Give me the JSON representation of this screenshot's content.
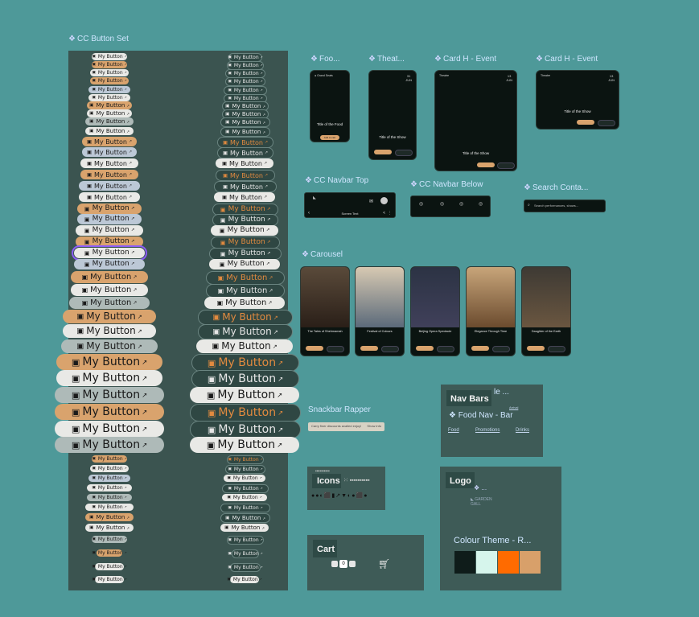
{
  "frames": {
    "button_set": "CC Button Set",
    "food": "Foo...",
    "theatre": "Theat...",
    "card_h_event_1": "Card H - Event",
    "card_h_event_2": "Card H - Event",
    "navbar_top": "CC Navbar Top",
    "navbar_below": "CC Navbar Below",
    "search_container": "Search Conta...",
    "carousel": "Carousel",
    "snackbar": "Snackbar Rapper",
    "nav_bars": "Nav Bars",
    "food_nav": "Food Nav - Bar",
    "icons": "Icons",
    "logo": "Logo",
    "cart": "Cart",
    "colour_theme": "Colour Theme - R..."
  },
  "button_label": "My Button",
  "food_card": {
    "title": "Title of the Food",
    "button": "Add to cart"
  },
  "theatre_card": {
    "title": "Title of the Show",
    "date_day": "31",
    "date_month": "JUN"
  },
  "event_card_1": {
    "title": "Title of the Show",
    "date_day": "13",
    "date_month": "JUN",
    "badge": "Theatre"
  },
  "event_card_2": {
    "title": "Title of the Show",
    "date_day": "13",
    "date_month": "JUN",
    "badge": "Theatre"
  },
  "navbar_top": {
    "title": "Screen Text"
  },
  "search": {
    "placeholder": "Search performances, shows..."
  },
  "carousel_items": [
    {
      "title": "The Tales of Shehmamah"
    },
    {
      "title": "Festival of Colours"
    },
    {
      "title": "Beijing Opera Spectacle"
    },
    {
      "title": "Elegance Through Time"
    },
    {
      "title": "Daughter of the Earth"
    }
  ],
  "snackbar": {
    "text": "Carry finer discounts availed enjoy!",
    "action": "Show info"
  },
  "food_nav_links": [
    "Food",
    "Promotions",
    "Drinks"
  ],
  "cart_counter": "0",
  "colours": [
    "#0f1c1a",
    "#d6f5ec",
    "#ff6b00",
    "#d8a06a"
  ]
}
